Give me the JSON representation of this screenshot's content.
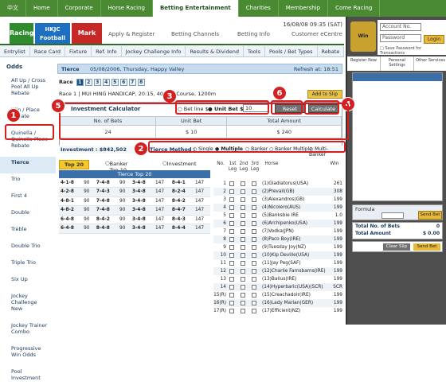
{
  "topnav": {
    "items": [
      "中文",
      "Home",
      "Corporate",
      "Horse Racing",
      "Betting Entertainment",
      "Charities",
      "Membership",
      "Come Racing"
    ]
  },
  "brand": {
    "tabs": [
      "Racing",
      "HKJC Football",
      "Mark Six"
    ],
    "sub": [
      "Apply & Register",
      "Betting Channels",
      "Betting Info",
      "Customer eCentre"
    ],
    "date": "16/08/08 09:35 (SAT)"
  },
  "subnav": [
    "Entrylist",
    "Race Card",
    "Fixture",
    "Ref. Info",
    "Jockey Challenge Info",
    "Results & Dividend",
    "Tools",
    "Pools / Bet Types",
    "Rebate"
  ],
  "left": {
    "header": "Odds",
    "items": [
      "All Up / Cross Pool All Up Rebate",
      "Win / Place Rebate",
      "Quinella / Quinella Place Rebate",
      "Tierce",
      "Trio",
      "First 4",
      "Double",
      "Treble",
      "Double Trio",
      "Triple Trio",
      "Six Up",
      "Jockey Challenge New",
      "Jockey Trainer Combo",
      "Progressive Win Odds",
      "Pool Investment"
    ]
  },
  "main": {
    "bar_title": "Tierce",
    "bar_date": "05/08/2006, Thursday, Happy Valley",
    "refresh": "Refresh at: 18:51",
    "race_label": "Race",
    "races": [
      "1",
      "2",
      "3",
      "4",
      "5",
      "6",
      "7",
      "8"
    ],
    "race_info": "Race 1 | MUI HING HANDICAP, 20:15, 40 | 'C' Course, 1200m",
    "add_slip": "Add to Slip",
    "calc": {
      "title": "Investment Calculator",
      "bet_opt": "Bet line $",
      "unit_opt": "Unit Bet $",
      "amount": "10",
      "reset": "Reset",
      "calculate": "Calculate",
      "headers": [
        "No. of Bets",
        "Unit Bet",
        "Total Amount"
      ],
      "values": [
        "24",
        "$ 10",
        "$ 240"
      ]
    },
    "investment": "Investment : $842,502",
    "method_label": "Tierce Method :",
    "methods": [
      "Single",
      "Multiple",
      "Banker",
      "Banker Multiple",
      "Multi-Banker"
    ],
    "top20": {
      "tabs": [
        "Top 20",
        "Banker Top 10",
        "Investment"
      ],
      "heading": "Tierce Top 20",
      "rows": [
        [
          "4-1-8",
          "90",
          "7-4-8",
          "90",
          "3-4-8",
          "147",
          "8-4-1",
          "147"
        ],
        [
          "4-2-8",
          "90",
          "7-4-3",
          "90",
          "3-4-8",
          "147",
          "8-2-4",
          "147"
        ],
        [
          "4-8-1",
          "90",
          "7-4-8",
          "90",
          "3-4-8",
          "147",
          "8-4-2",
          "147"
        ],
        [
          "4-8-2",
          "90",
          "7-4-8",
          "90",
          "3-4-8",
          "147",
          "8-4-7",
          "147"
        ],
        [
          "6-4-8",
          "90",
          "8-4-2",
          "90",
          "3-4-8",
          "147",
          "8-4-3",
          "147"
        ],
        [
          "6-4-8",
          "90",
          "8-4-8",
          "90",
          "3-4-8",
          "147",
          "8-4-4",
          "147"
        ]
      ]
    },
    "horses": {
      "headers": [
        "No.",
        "1st Leg",
        "2nd Leg",
        "3rd Leg",
        "Horse",
        "Win"
      ],
      "rows": [
        [
          "1",
          "(1)Gladiatorus(USA)",
          "261"
        ],
        [
          "2",
          "(2)Prevail(GB)",
          "308"
        ],
        [
          "3",
          "(3)Alexandros(GB)",
          "199"
        ],
        [
          "4",
          "(4)Nicolero(AUS)",
          "199"
        ],
        [
          "5",
          "(5)Banksbie IRE",
          "1.0"
        ],
        [
          "6",
          "(6)Archipenko(USA)",
          "199"
        ],
        [
          "7",
          "(7)Vodka(JPN)",
          "199"
        ],
        [
          "8",
          "(8)Paco Boy(IRE)",
          "199"
        ],
        [
          "9",
          "(9)Tuesday Joy(NZ)",
          "199"
        ],
        [
          "10",
          "(10)Kip Deville(USA)",
          "199"
        ],
        [
          "11",
          "(11)Jay Peg(SAF)",
          "199"
        ],
        [
          "12",
          "(12)Charlie Farnsbarns(IRE)",
          "199"
        ],
        [
          "13",
          "(13)Balius(IRE)",
          "199"
        ],
        [
          "14",
          "(14)Hyperbaric(USA)(SCR)",
          "SCR"
        ],
        [
          "15(R)",
          "(15)Creachadoir(IRE)",
          "199"
        ],
        [
          "16(R)",
          "(16)Lady Marian(GER)",
          "199"
        ],
        [
          "17(R)",
          "(17)Efficient(NZ)",
          "199"
        ]
      ]
    }
  },
  "right": {
    "logo": "Win",
    "account": "Account No.",
    "password": "Password",
    "login": "Login",
    "save": "Save Password for Transactions",
    "links": [
      "Register Now",
      "Personal Settings",
      "Other Services"
    ],
    "formula": "Formula",
    "send_bet": "Send Bet",
    "total_bets": "Total No. of Bets",
    "total_amount": "Total Amount",
    "total_bets_val": "0",
    "total_amount_val": "$ 0.00",
    "clear": "Clear Slip",
    "send": "Send Bet"
  },
  "annotations": [
    "1",
    "2",
    "3",
    "4",
    "5",
    "6"
  ],
  "colors": {
    "nav_green": "#4a8a32",
    "accent_gold": "#e8b838",
    "annotation_red": "#d32020",
    "header_blue": "#3b6fa8"
  }
}
